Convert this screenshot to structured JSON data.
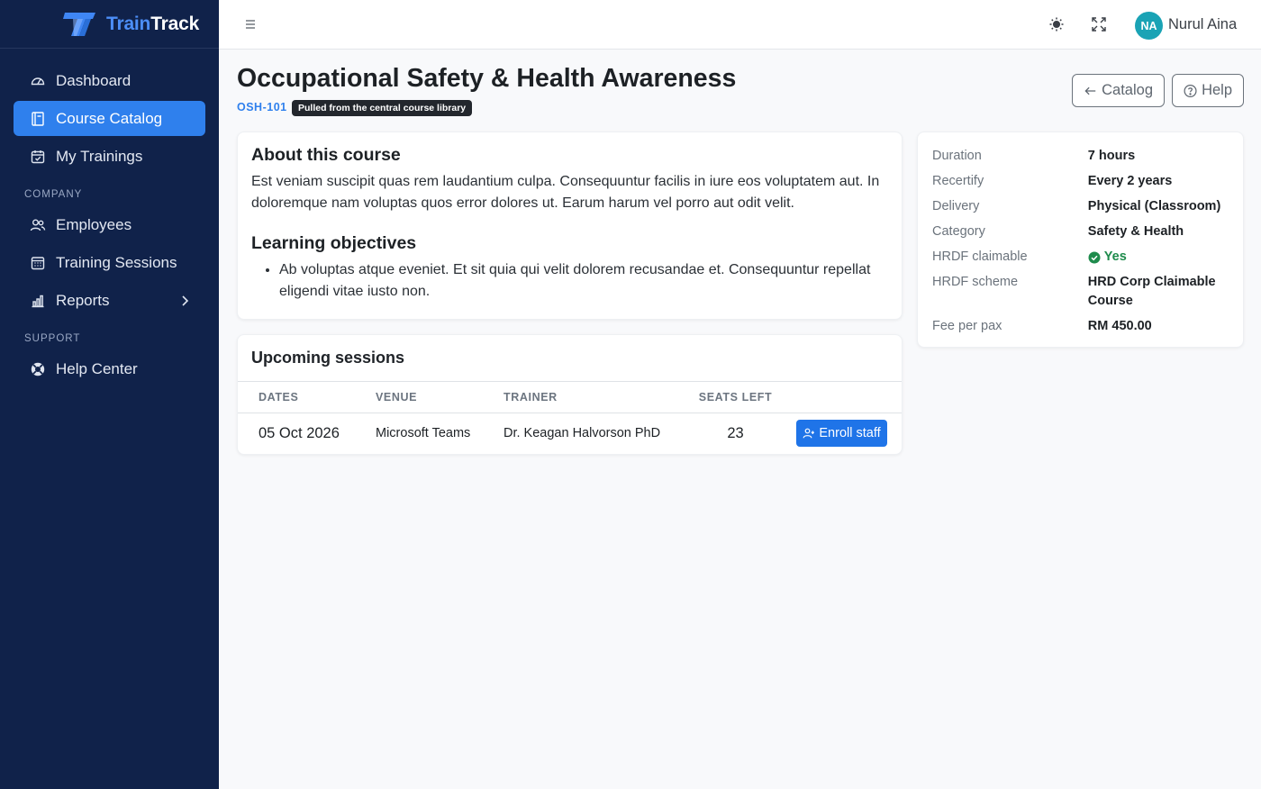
{
  "brand": {
    "part1": "Train",
    "part2": "Track"
  },
  "sidebar": {
    "items": [
      {
        "label": "Dashboard"
      },
      {
        "label": "Course Catalog"
      },
      {
        "label": "My Trainings"
      }
    ],
    "section_company": "COMPANY",
    "company_items": [
      {
        "label": "Employees"
      },
      {
        "label": "Training Sessions"
      },
      {
        "label": "Reports"
      }
    ],
    "section_support": "SUPPORT",
    "support_items": [
      {
        "label": "Help Center"
      }
    ]
  },
  "user": {
    "initials": "NA",
    "name": "Nurul Aina"
  },
  "course": {
    "title": "Occupational Safety & Health Awareness",
    "code": "OSH-101",
    "badge": "Pulled from the central course library",
    "catalog_label": "Catalog",
    "help_label": "Help",
    "about_heading": "About this course",
    "about_text": "Est veniam suscipit quas rem laudantium culpa. Consequuntur facilis in iure eos voluptatem aut. In doloremque nam voluptas quos error dolores ut. Earum harum vel porro aut odit velit.",
    "objectives_heading": "Learning objectives",
    "objectives": [
      "Ab voluptas atque eveniet. Et sit quia qui velit dolorem recusandae et. Consequuntur repellat eligendi vitae iusto non."
    ]
  },
  "sessions": {
    "heading": "Upcoming sessions",
    "columns": [
      "DATES",
      "VENUE",
      "TRAINER",
      "SEATS LEFT"
    ],
    "rows": [
      {
        "date": "05 Oct 2026",
        "venue": "Microsoft Teams",
        "trainer": "Dr. Keagan Halvorson PhD",
        "seats": "23",
        "action": "Enroll staff"
      }
    ]
  },
  "details": [
    {
      "label": "Duration",
      "value": "7 hours"
    },
    {
      "label": "Recertify",
      "value": "Every 2 years"
    },
    {
      "label": "Delivery",
      "value": "Physical (Classroom)"
    },
    {
      "label": "Category",
      "value": "Safety & Health"
    },
    {
      "label": "HRDF claimable",
      "value": "Yes"
    },
    {
      "label": "HRDF scheme",
      "value": "HRD Corp Claimable Course"
    },
    {
      "label": "Fee per pax",
      "value": "RM 450.00"
    }
  ],
  "colors": {
    "sidebar": "#10224a",
    "accent": "#2f80ed",
    "success": "#1e8b4c",
    "avatar": "#1aa3b5"
  }
}
